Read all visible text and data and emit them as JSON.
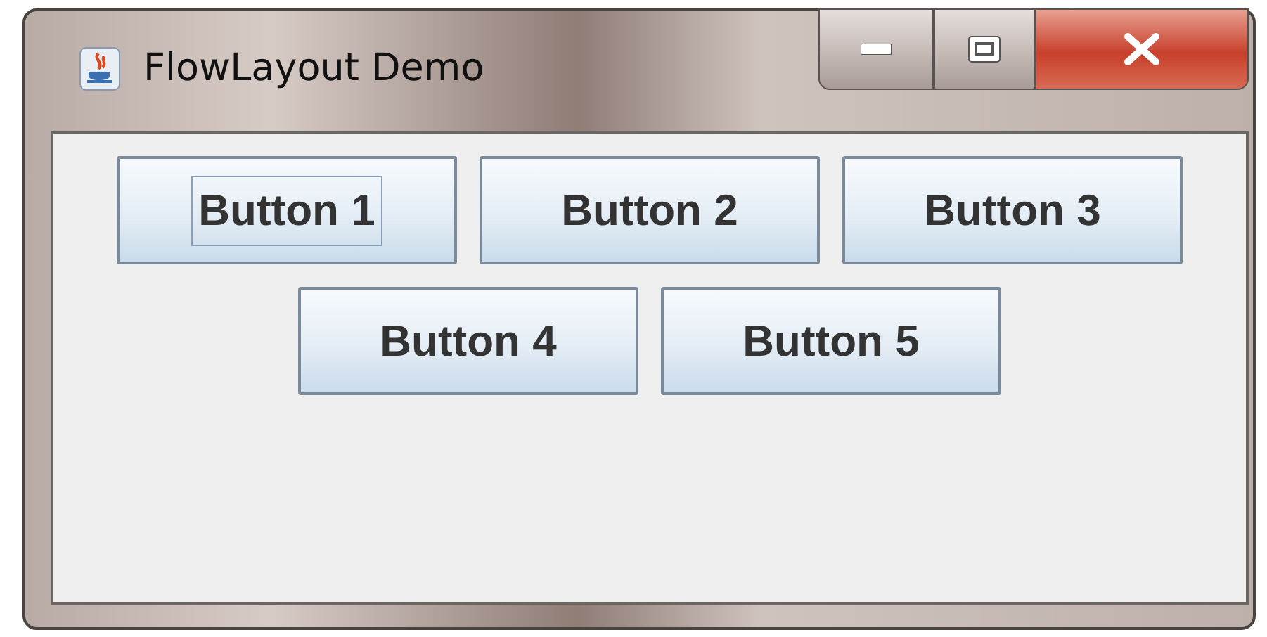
{
  "window": {
    "title": "FlowLayout Demo"
  },
  "buttons": [
    {
      "label": "Button 1",
      "focused": true
    },
    {
      "label": "Button 2",
      "focused": false
    },
    {
      "label": "Button 3",
      "focused": false
    },
    {
      "label": "Button 4",
      "focused": false
    },
    {
      "label": "Button 5",
      "focused": false
    }
  ]
}
